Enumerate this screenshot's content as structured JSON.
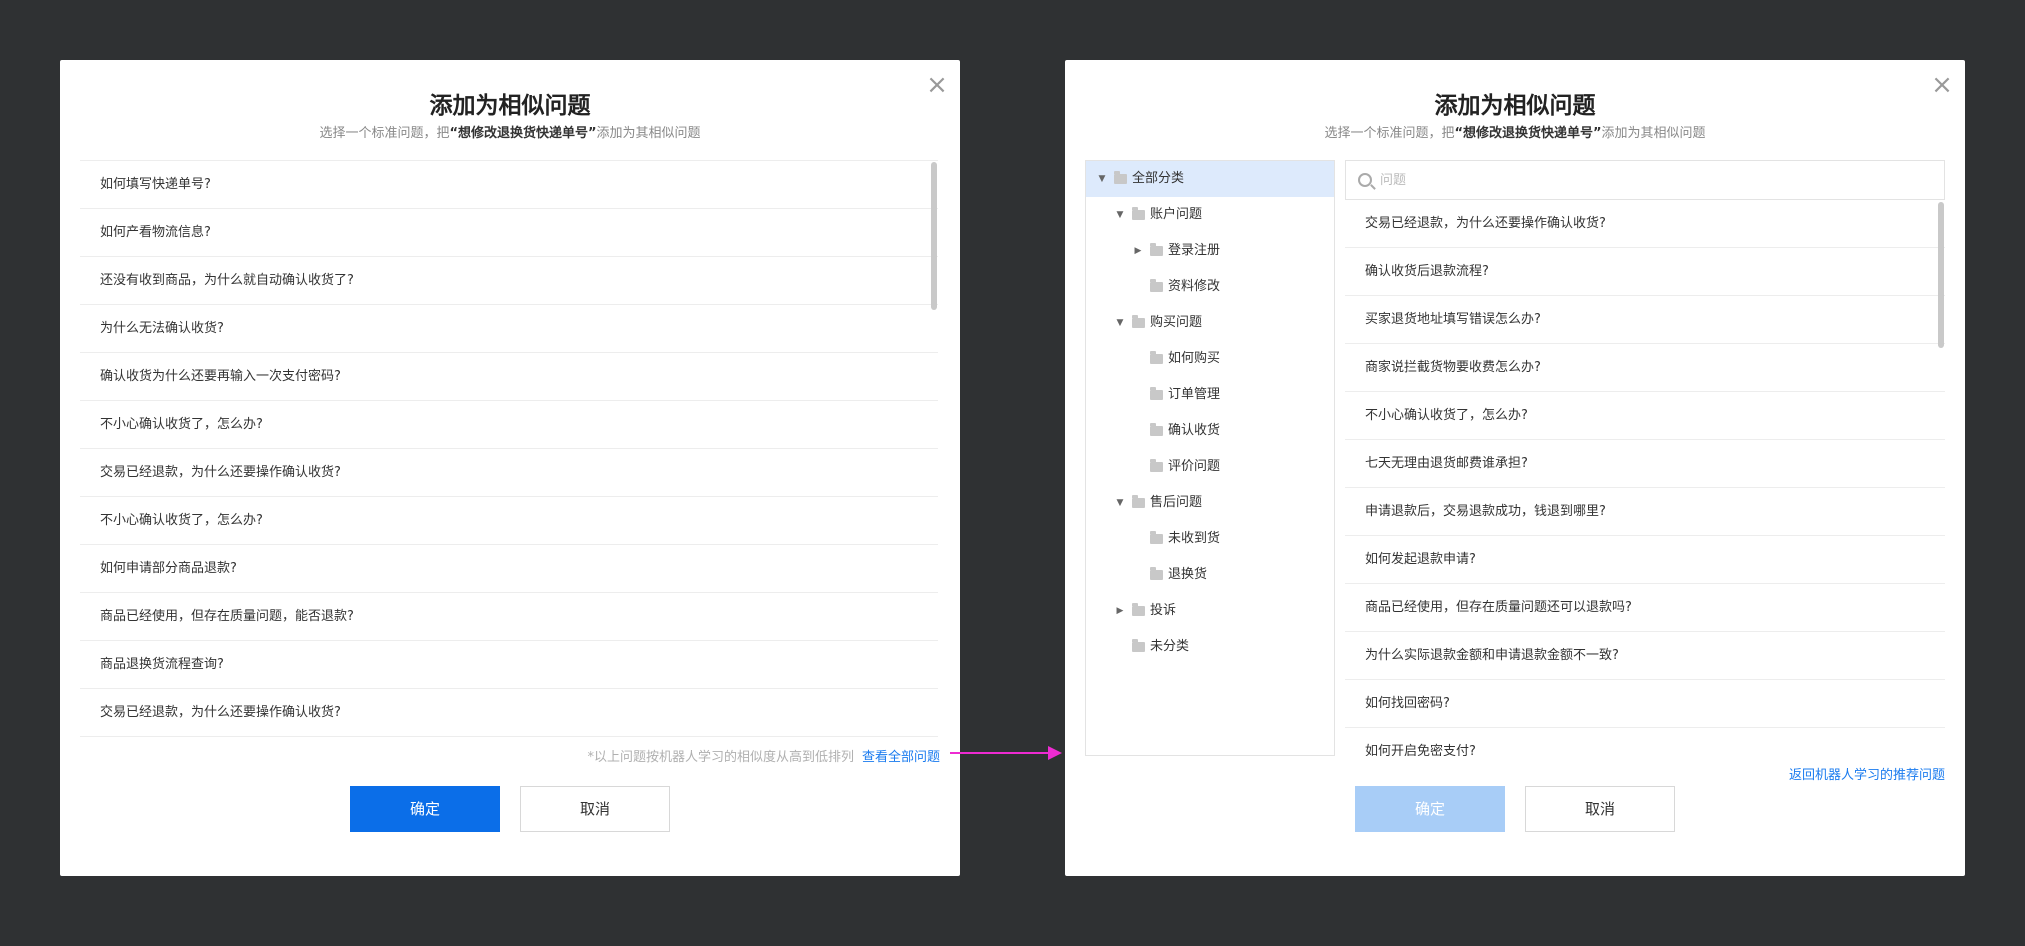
{
  "left_dialog": {
    "title": "添加为相似问题",
    "subtitle_prefix": "选择一个标准问题，把",
    "subtitle_highlight": "“想修改退换货快递单号”",
    "subtitle_suffix": "添加为其相似问题",
    "close_glyph": "×",
    "questions": [
      "如何填写快递单号?",
      "如何产看物流信息?",
      "还没有收到商品，为什么就自动确认收货了?",
      "为什么无法确认收货?",
      "确认收货为什么还要再输入一次支付密码?",
      "不小心确认收货了，怎么办?",
      "交易已经退款，为什么还要操作确认收货?",
      "不小心确认收货了，怎么办?",
      "如何申请部分商品退款?",
      "商品已经使用，但存在质量问题，能否退款?",
      "商品退换货流程查询?",
      "交易已经退款，为什么还要操作确认收货?"
    ],
    "hint": "*以上问题按机器人学习的相似度从高到低排列",
    "view_all": "查看全部问题",
    "confirm": "确定",
    "cancel": "取消"
  },
  "right_dialog": {
    "title": "添加为相似问题",
    "subtitle_prefix": "选择一个标准问题，把",
    "subtitle_highlight": "“想修改退换货快递单号”",
    "subtitle_suffix": "添加为其相似问题",
    "close_glyph": "×",
    "tree": [
      {
        "label": "全部分类",
        "caret": "▼"
      },
      {
        "label": "账户问题",
        "caret": "▼"
      },
      {
        "label": "登录注册",
        "caret": "▶"
      },
      {
        "label": "资料修改",
        "caret": ""
      },
      {
        "label": "购买问题",
        "caret": "▼"
      },
      {
        "label": "如何购买",
        "caret": ""
      },
      {
        "label": "订单管理",
        "caret": ""
      },
      {
        "label": "确认收货",
        "caret": ""
      },
      {
        "label": "评价问题",
        "caret": ""
      },
      {
        "label": "售后问题",
        "caret": "▼"
      },
      {
        "label": "未收到货",
        "caret": ""
      },
      {
        "label": "退换货",
        "caret": ""
      },
      {
        "label": "投诉",
        "caret": "▶"
      },
      {
        "label": "未分类",
        "caret": ""
      }
    ],
    "search_placeholder": "问题",
    "questions": [
      "交易已经退款，为什么还要操作确认收货?",
      "确认收货后退款流程?",
      "买家退货地址填写错误怎么办?",
      "商家说拦截货物要收费怎么办?",
      "不小心确认收货了，怎么办?",
      "七天无理由退货邮费谁承担?",
      "申请退款后，交易退款成功，钱退到哪里?",
      "如何发起退款申请?",
      "商品已经使用，但存在质量问题还可以退款吗?",
      "为什么实际退款金额和申请退款金额不一致?",
      "如何找回密码?",
      "如何开启免密支付?"
    ],
    "back_link": "返回机器人学习的推荐问题",
    "confirm": "确定",
    "cancel": "取消"
  },
  "colors": {
    "background": "#2f3133",
    "primary": "#0b6ee8",
    "primary_disabled": "#a8cdf7",
    "link": "#1a7bef",
    "arrow": "#ee2bd2",
    "tree_selected": "#ddeafc"
  }
}
